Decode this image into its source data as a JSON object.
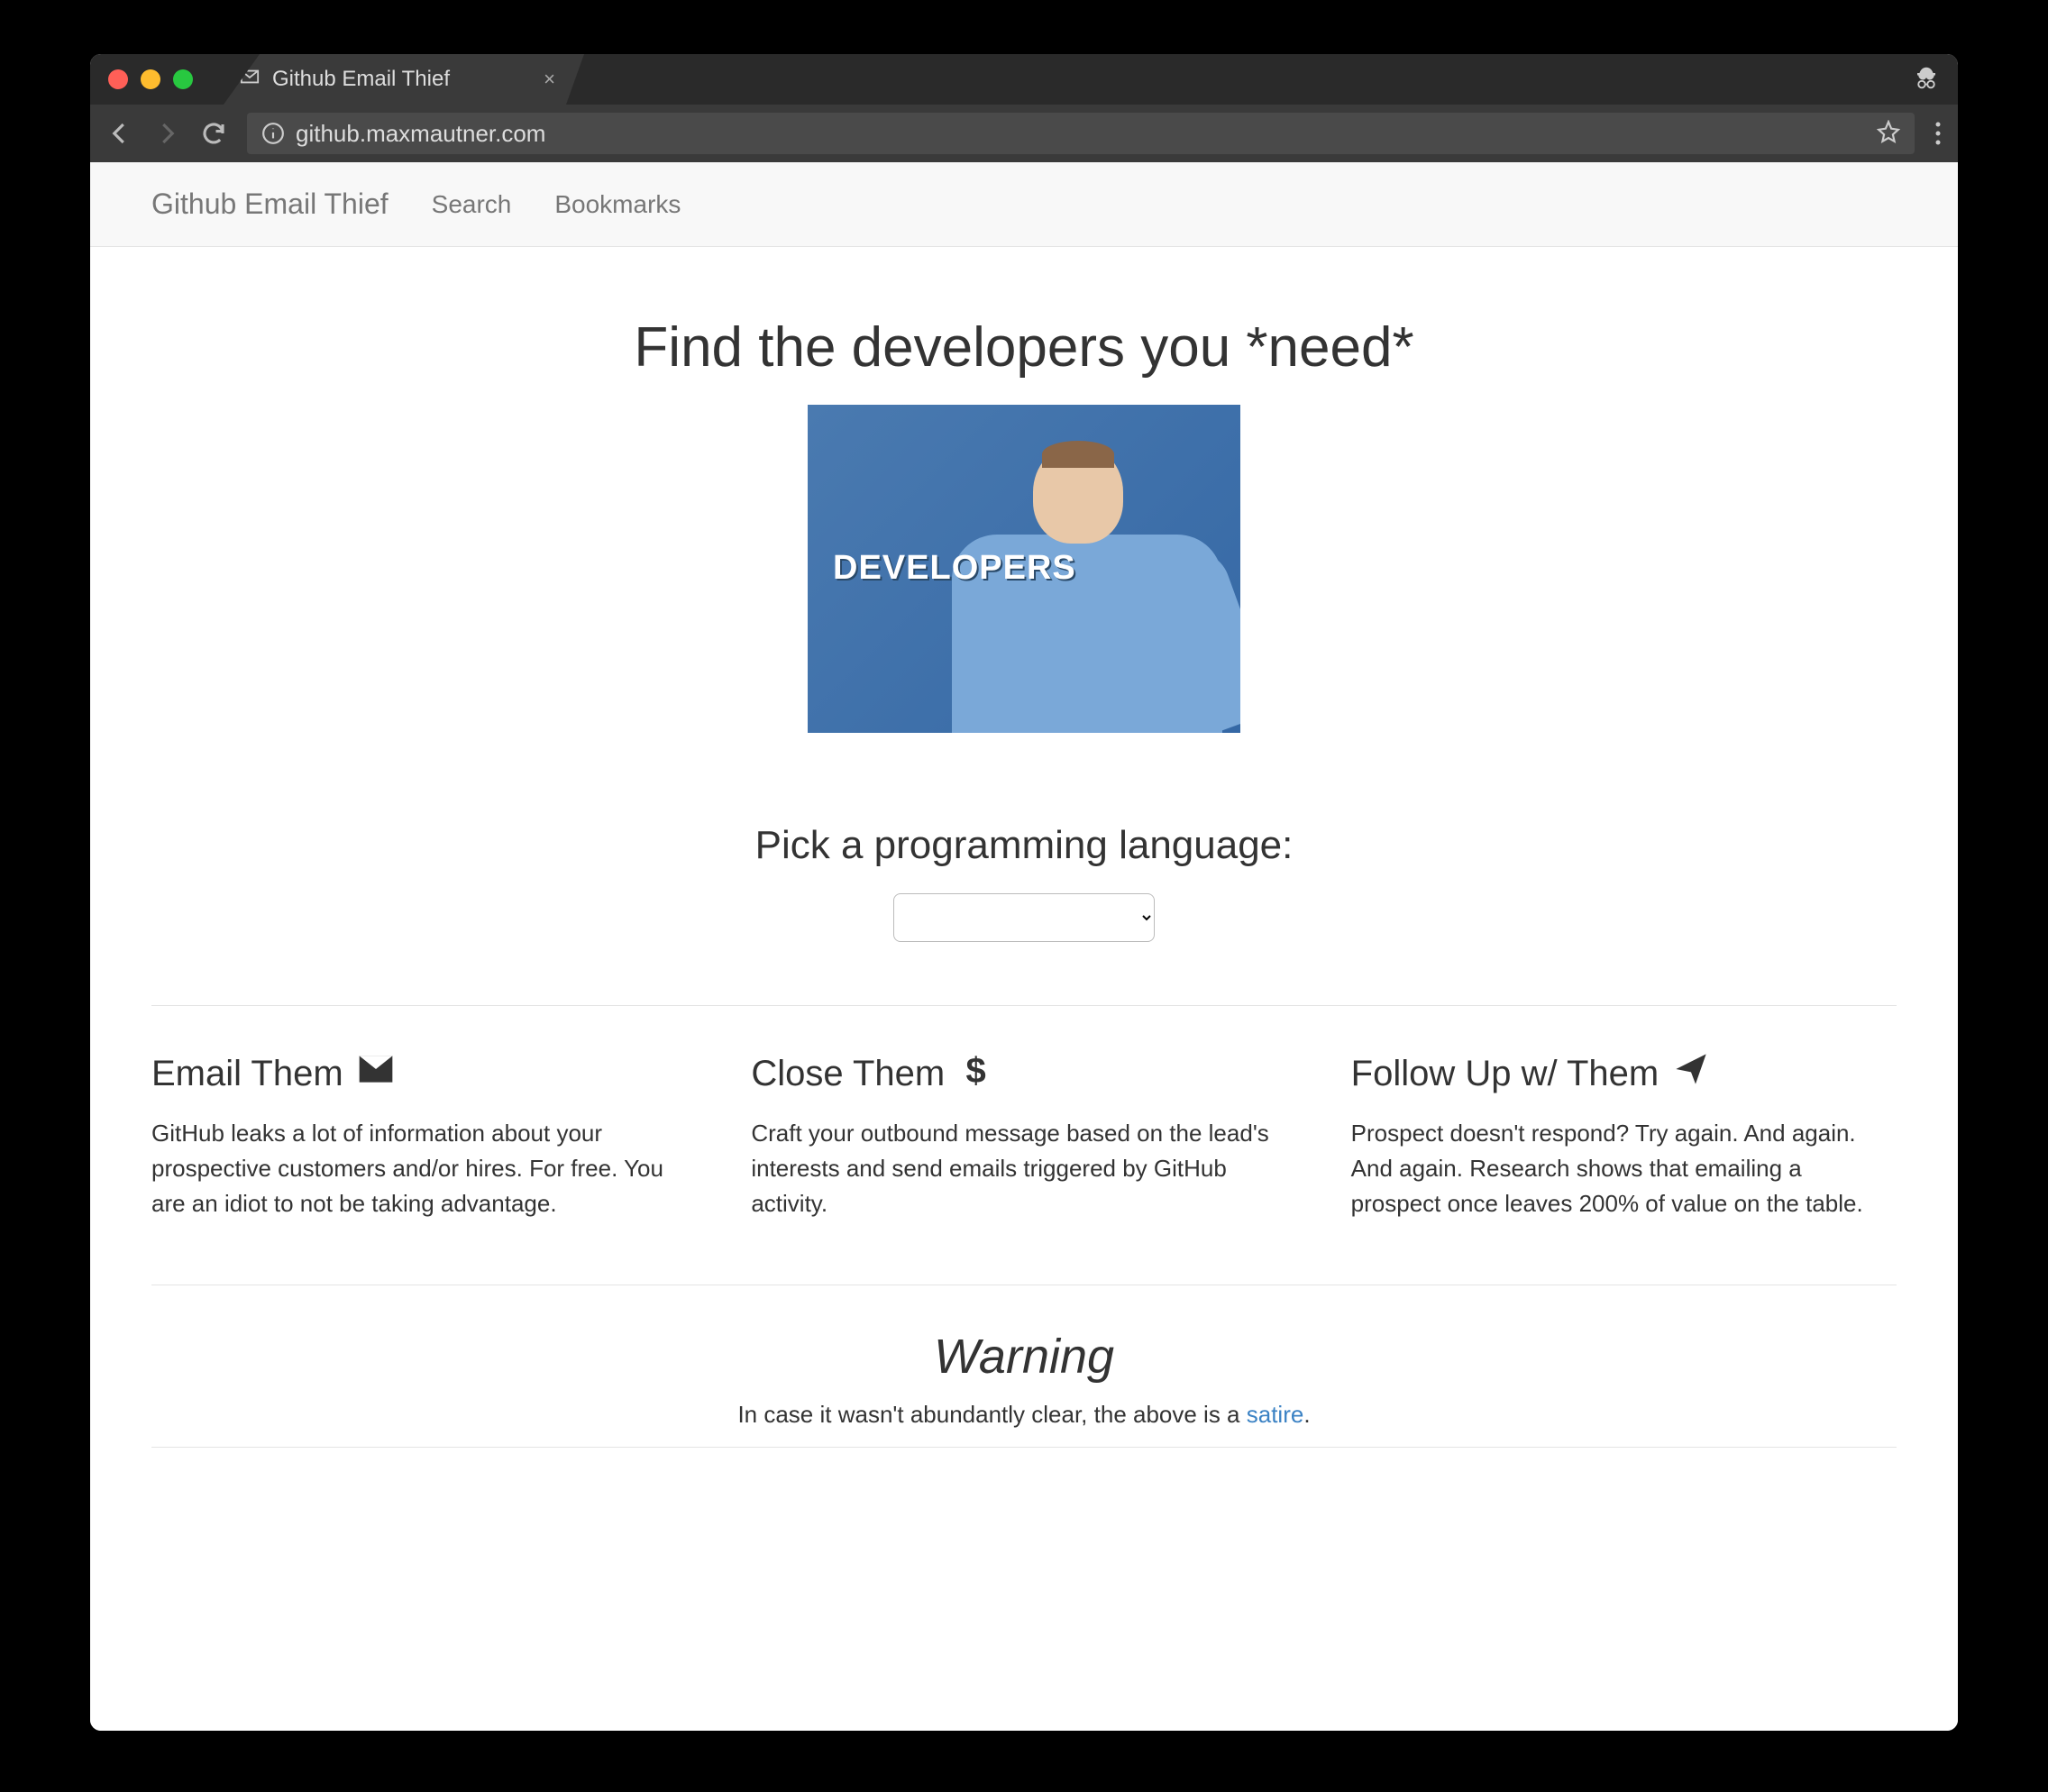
{
  "browser": {
    "tab_title": "Github Email Thief",
    "url": "github.maxmautner.com"
  },
  "nav": {
    "brand": "Github Email Thief",
    "links": [
      "Search",
      "Bookmarks"
    ]
  },
  "hero": {
    "heading": "Find the developers you *need*",
    "image_caption": "DEVELOPERS"
  },
  "picker": {
    "heading": "Pick a programming language:",
    "value": ""
  },
  "columns": [
    {
      "title": "Email Them",
      "icon": "envelope-icon",
      "body": "GitHub leaks a lot of information about your prospective customers and/or hires. For free. You are an idiot to not be taking advantage."
    },
    {
      "title": "Close Them",
      "icon": "dollar-icon",
      "body": "Craft your outbound message based on the lead's interests and send emails triggered by GitHub activity."
    },
    {
      "title": "Follow Up w/ Them",
      "icon": "paper-plane-icon",
      "body": "Prospect doesn't respond? Try again. And again. And again. Research shows that emailing a prospect once leaves 200% of value on the table."
    }
  ],
  "warning": {
    "heading": "Warning",
    "text_before": "In case it wasn't abundantly clear, the above is a ",
    "link_text": "satire",
    "text_after": "."
  }
}
